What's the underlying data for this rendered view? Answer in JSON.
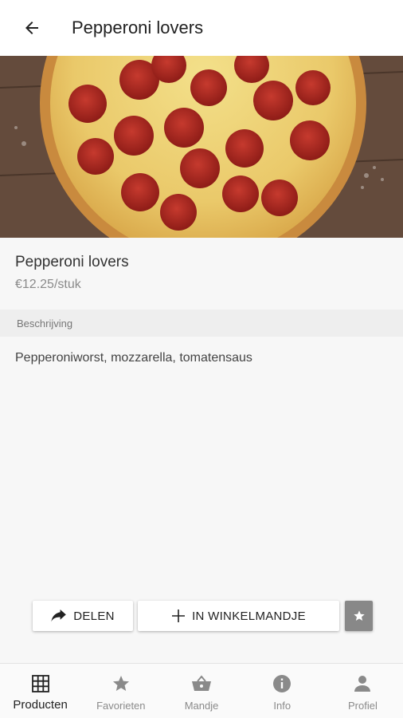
{
  "app_bar": {
    "title": "Pepperoni lovers",
    "back_icon": "arrow-left"
  },
  "product": {
    "name": "Pepperoni lovers",
    "price": "€12.25/stuk"
  },
  "section": {
    "description_header": "Beschrijving"
  },
  "description": {
    "text": "Pepperoniworst, mozzarella, tomatensaus"
  },
  "actions": {
    "share_label": "DELEN",
    "add_to_cart_label": "IN WINKELMANDJE",
    "favorite_icon": "star"
  },
  "bottom_nav": {
    "items": [
      {
        "label": "Producten",
        "icon": "grid",
        "active": true
      },
      {
        "label": "Favorieten",
        "icon": "star",
        "active": false
      },
      {
        "label": "Mandje",
        "icon": "basket",
        "active": false
      },
      {
        "label": "Info",
        "icon": "info",
        "active": false
      },
      {
        "label": "Profiel",
        "icon": "person",
        "active": false
      }
    ]
  },
  "colors": {
    "accent": "#222222",
    "inactive": "#8a8a8a",
    "favorite_bg": "#888888"
  }
}
